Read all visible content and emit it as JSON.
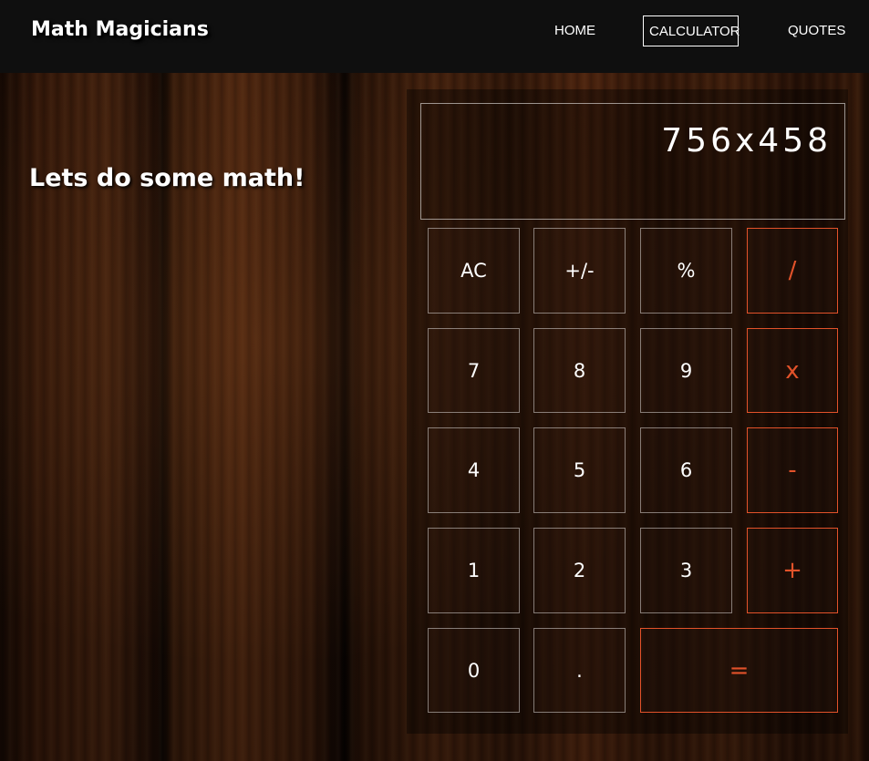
{
  "navbar": {
    "brand": "Math Magicians",
    "links": [
      {
        "label": "HOME",
        "active": false
      },
      {
        "label": "CALCULATOR",
        "active": true
      },
      {
        "label": "QUOTES",
        "active": false
      }
    ]
  },
  "main": {
    "headline": "Lets do some math!"
  },
  "calculator": {
    "display": "756x458",
    "accent_color": "#e2522a",
    "keys": {
      "ac": "AC",
      "sign": "+/-",
      "percent": "%",
      "divide": "/",
      "seven": "7",
      "eight": "8",
      "nine": "9",
      "multiply": "x",
      "four": "4",
      "five": "5",
      "six": "6",
      "subtract": "-",
      "one": "1",
      "two": "2",
      "three": "3",
      "add": "+",
      "zero": "0",
      "dot": ".",
      "equals": "="
    }
  }
}
